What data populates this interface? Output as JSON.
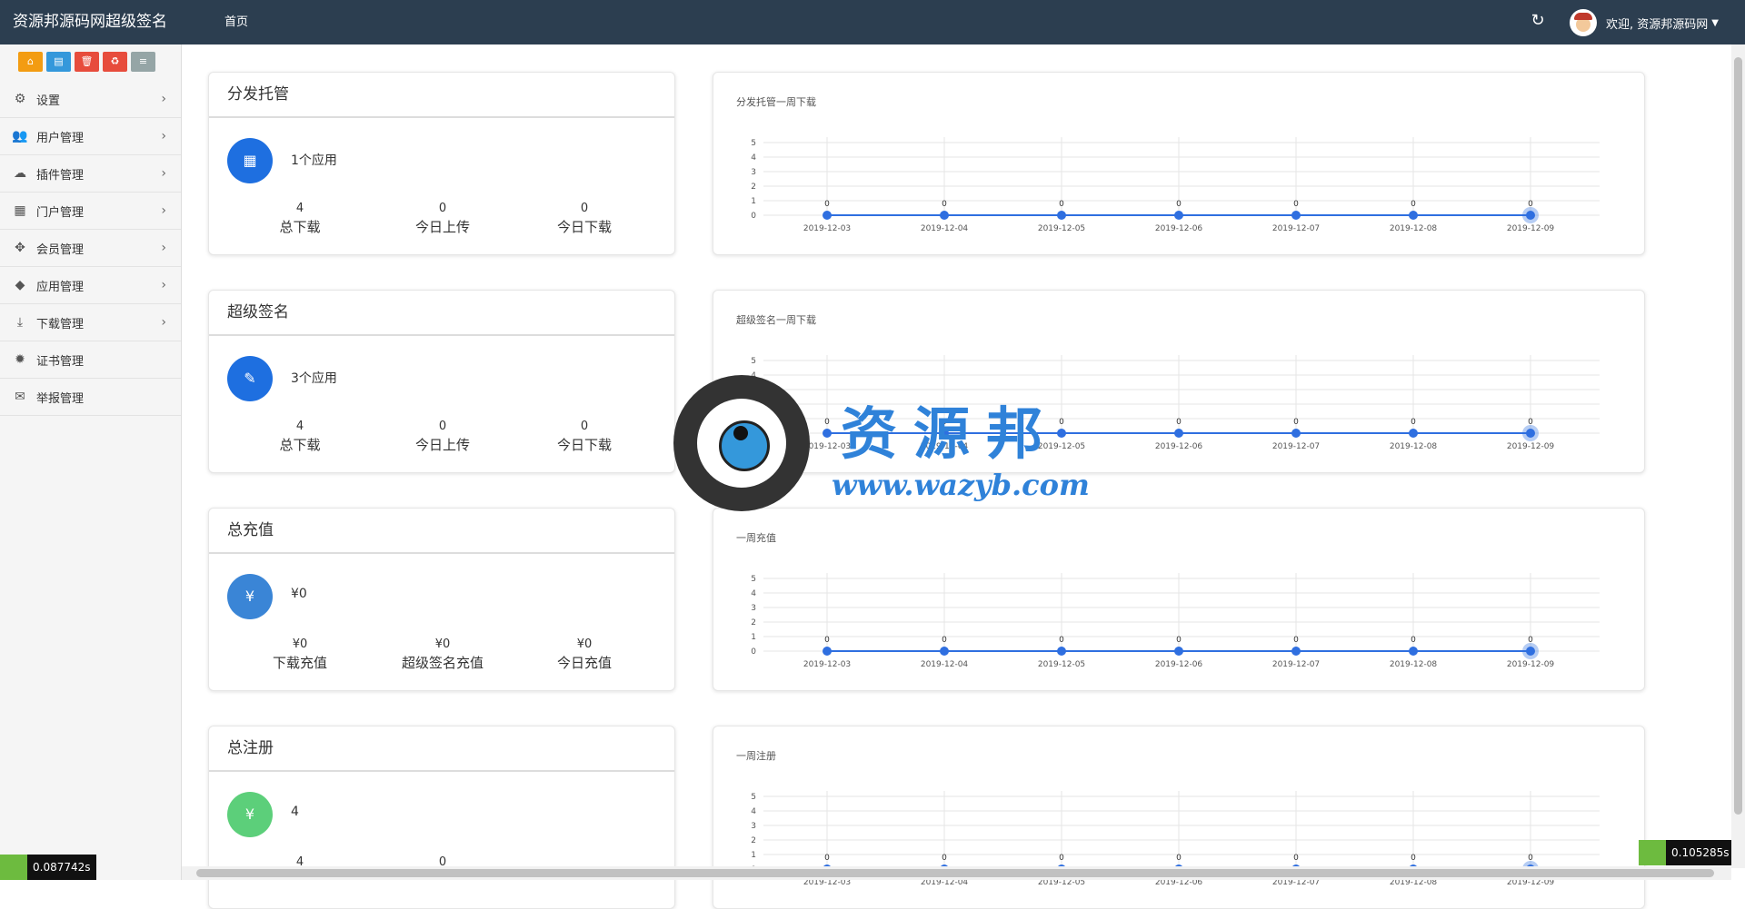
{
  "topbar": {
    "brand": "资源邦源码网超级签名",
    "nav_home": "首页",
    "refresh_icon": "refresh-icon",
    "user_greeting": "欢迎, 资源邦源码网"
  },
  "sidebar": {
    "quick_buttons": [
      {
        "icon": "home-icon",
        "color": "#f39c12"
      },
      {
        "icon": "file-icon",
        "color": "#3498db"
      },
      {
        "icon": "trash-icon",
        "color": "#e74c3c"
      },
      {
        "icon": "recycle-icon",
        "color": "#e74c3c"
      },
      {
        "icon": "list-icon",
        "color": "#95a5a6"
      }
    ],
    "items": [
      {
        "label": "设置",
        "icon": "gears-icon",
        "chevron": true
      },
      {
        "label": "用户管理",
        "icon": "users-icon",
        "chevron": true
      },
      {
        "label": "插件管理",
        "icon": "cloud-icon",
        "chevron": true
      },
      {
        "label": "门户管理",
        "icon": "grid-icon",
        "chevron": true
      },
      {
        "label": "会员管理",
        "icon": "move-icon",
        "chevron": true
      },
      {
        "label": "应用管理",
        "icon": "android-icon",
        "chevron": true
      },
      {
        "label": "下载管理",
        "icon": "download-icon",
        "chevron": true
      },
      {
        "label": "证书管理",
        "icon": "certificate-icon",
        "chevron": false
      },
      {
        "label": "举报管理",
        "icon": "envelope-icon",
        "chevron": false
      }
    ]
  },
  "stats": [
    {
      "title": "分发托管",
      "icon": "calendar-icon",
      "icon_color": "#1e6fe0",
      "main": "1个应用",
      "cols": [
        {
          "value": "4",
          "label": "总下载"
        },
        {
          "value": "0",
          "label": "今日上传"
        },
        {
          "value": "0",
          "label": "今日下载"
        }
      ]
    },
    {
      "title": "超级签名",
      "icon": "pencil-icon",
      "icon_color": "#1e6fe0",
      "main": "3个应用",
      "cols": [
        {
          "value": "4",
          "label": "总下载"
        },
        {
          "value": "0",
          "label": "今日上传"
        },
        {
          "value": "0",
          "label": "今日下载"
        }
      ]
    },
    {
      "title": "总充值",
      "icon": "yen-icon",
      "icon_color": "#3a85d6",
      "main": "¥0",
      "cols": [
        {
          "value": "¥0",
          "label": "下载充值"
        },
        {
          "value": "¥0",
          "label": "超级签名充值"
        },
        {
          "value": "¥0",
          "label": "今日充值"
        }
      ]
    },
    {
      "title": "总注册",
      "icon": "yen-icon",
      "icon_color": "#5ccf7a",
      "main": "4",
      "cols": [
        {
          "value": "4",
          "label": ""
        },
        {
          "value": "0",
          "label": ""
        }
      ]
    }
  ],
  "chart_data": [
    {
      "type": "line",
      "title": "分发托管一周下载",
      "x": [
        "2019-12-03",
        "2019-12-04",
        "2019-12-05",
        "2019-12-06",
        "2019-12-07",
        "2019-12-08",
        "2019-12-09"
      ],
      "series": [
        {
          "values": [
            0,
            0,
            0,
            0,
            0,
            0,
            0
          ],
          "color": "#2f6fe0"
        }
      ],
      "ylim": [
        0,
        5
      ],
      "yticks": [
        0,
        1,
        2,
        3,
        4,
        5
      ],
      "grid": true
    },
    {
      "type": "line",
      "title": "超级签名一周下载",
      "x": [
        "2019-12-03",
        "2019-12-04",
        "2019-12-05",
        "2019-12-06",
        "2019-12-07",
        "2019-12-08",
        "2019-12-09"
      ],
      "series": [
        {
          "values": [
            0,
            0,
            0,
            0,
            0,
            0,
            0
          ],
          "color": "#2f6fe0"
        }
      ],
      "ylim": [
        0,
        5
      ],
      "yticks": [
        0,
        1,
        2,
        3,
        4,
        5
      ],
      "grid": true
    },
    {
      "type": "line",
      "title": "一周充值",
      "x": [
        "2019-12-03",
        "2019-12-04",
        "2019-12-05",
        "2019-12-06",
        "2019-12-07",
        "2019-12-08",
        "2019-12-09"
      ],
      "series": [
        {
          "values": [
            0,
            0,
            0,
            0,
            0,
            0,
            0
          ],
          "color": "#2f6fe0"
        }
      ],
      "ylim": [
        0,
        5
      ],
      "yticks": [
        0,
        1,
        2,
        3,
        4,
        5
      ],
      "grid": true
    },
    {
      "type": "line",
      "title": "一周注册",
      "x": [
        "2019-12-03",
        "2019-12-04",
        "2019-12-05",
        "2019-12-06",
        "2019-12-07",
        "2019-12-08",
        "2019-12-09"
      ],
      "series": [
        {
          "values": [
            0,
            0,
            0,
            0,
            0,
            0,
            0
          ],
          "color": "#2f6fe0"
        }
      ],
      "ylim": [
        0,
        5
      ],
      "yticks": [
        0,
        1,
        2,
        3,
        4,
        5
      ],
      "grid": true
    }
  ],
  "watermark": {
    "text": "资源邦",
    "url": "www.wazyb.com"
  },
  "perf": {
    "left": "0.087742s",
    "right": "0.105285s"
  }
}
